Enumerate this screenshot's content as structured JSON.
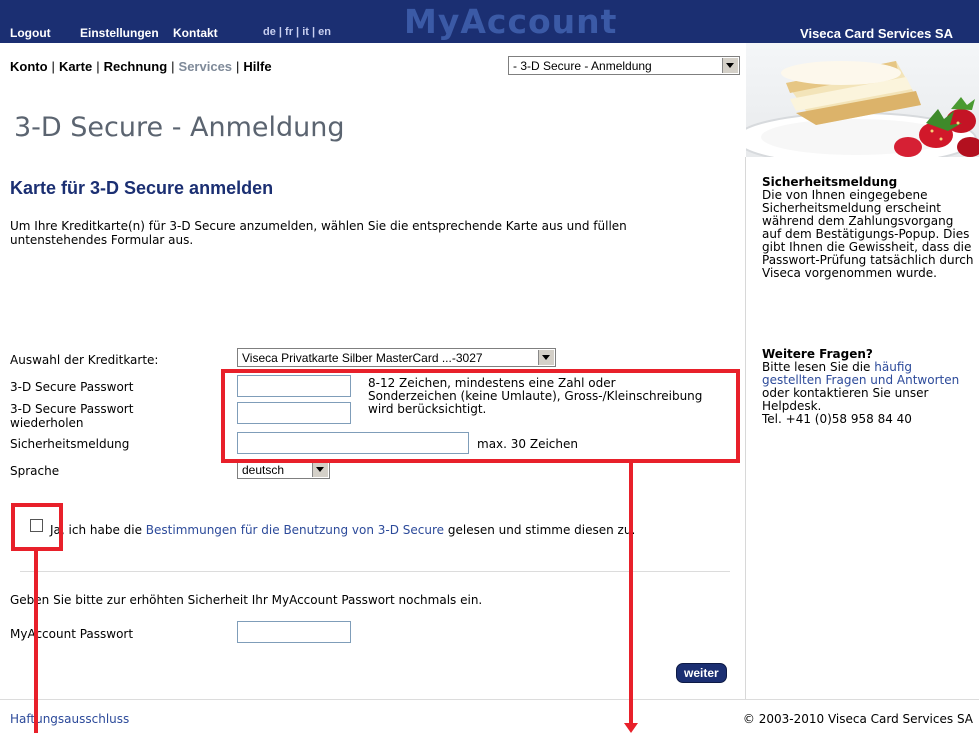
{
  "header": {
    "links": [
      "Logout",
      "Einstellungen",
      "Kontakt"
    ],
    "languages": [
      "de",
      "fr",
      "it",
      "en"
    ],
    "wordmark": "MyAccount",
    "company": "Viseca Card Services SA"
  },
  "nav": {
    "items": [
      "Konto",
      "Karte",
      "Rechnung",
      "Services",
      "Hilfe"
    ],
    "active": "Services",
    "page_select_value": "- 3-D Secure - Anmeldung"
  },
  "page_title": "3-D Secure - Anmeldung",
  "section_title": "Karte für 3-D Secure anmelden",
  "intro_text": "Um Ihre Kreditkarte(n) für 3-D Secure anzumelden, wählen Sie die entsprechende Karte aus und füllen untenstehendes Formular aus.",
  "form": {
    "card_label": "Auswahl der Kreditkarte:",
    "card_value": "Viseca Privatkarte Silber MasterCard ...-3027",
    "password_label": "3-D Secure Passwort",
    "password_repeat_label": "3-D Secure Passwort wiederholen",
    "password_hint": "8-12 Zeichen, mindestens eine Zahl oder Sonderzeichen (keine Umlaute), Gross-/Kleinschreibung wird berücksichtigt.",
    "security_label": "Sicherheitsmeldung",
    "security_hint": "max. 30 Zeichen",
    "language_label": "Sprache",
    "language_value": "deutsch",
    "terms_prefix": "Ja, ich habe die ",
    "terms_link": "Bestimmungen für die Benutzung von 3-D Secure",
    "terms_suffix": " gelesen und stimme diesen zu.",
    "reenter_text": "Geben Sie bitte zur erhöhten Sicherheit Ihr MyAccount Passwort nochmals ein.",
    "myaccount_label": "MyAccount Passwort",
    "submit_label": "weiter"
  },
  "sidebar": {
    "security_title": "Sicherheitsmeldung",
    "security_text": "Die von Ihnen eingegebene Sicherheitsmeldung erscheint während dem Zahlungsvorgang auf dem Bestätigungs-Popup. Dies gibt Ihnen die Gewissheit, dass die Passwort-Prüfung tatsächlich durch Viseca vorgenommen wurde.",
    "questions_title": "Weitere Fragen?",
    "questions_prefix": "Bitte lesen Sie die ",
    "questions_link": "häufig gestellten Fragen und Antworten",
    "questions_suffix": " oder kontaktieren Sie unser Helpdesk.",
    "phone": "Tel. +41 (0)58 958 84 40"
  },
  "footer": {
    "disclaimer": "Haftungsausschluss",
    "copyright": "© 2003-2010 Viseca Card Services SA"
  },
  "colors": {
    "header_bg": "#1b2f72",
    "title_blue": "#1b2f72",
    "link_blue": "#2c4a9a",
    "annotation_red": "#e8202a"
  }
}
